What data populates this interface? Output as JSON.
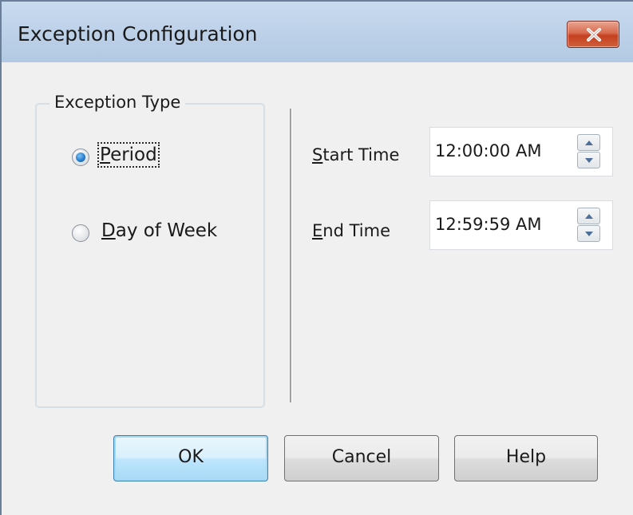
{
  "window": {
    "title": "Exception Configuration",
    "close_label": "×"
  },
  "exception_type": {
    "legend": "Exception Type",
    "options": [
      {
        "label": "Period",
        "selected": true
      },
      {
        "label": "Day of Week",
        "selected": false
      }
    ]
  },
  "start_time": {
    "label": "Start Time",
    "value": "12:00:00 AM"
  },
  "end_time": {
    "label": "End Time",
    "value": "12:59:59 AM"
  },
  "buttons": {
    "ok": "OK",
    "cancel": "Cancel",
    "help": "Help"
  },
  "colors": {
    "accent": "#3c7fb1",
    "close_red": "#c4401f",
    "title_bar": "#bcd0e8"
  },
  "icons": {
    "close": "close-icon",
    "spin_up": "chevron-up-icon",
    "spin_down": "chevron-down-icon"
  }
}
